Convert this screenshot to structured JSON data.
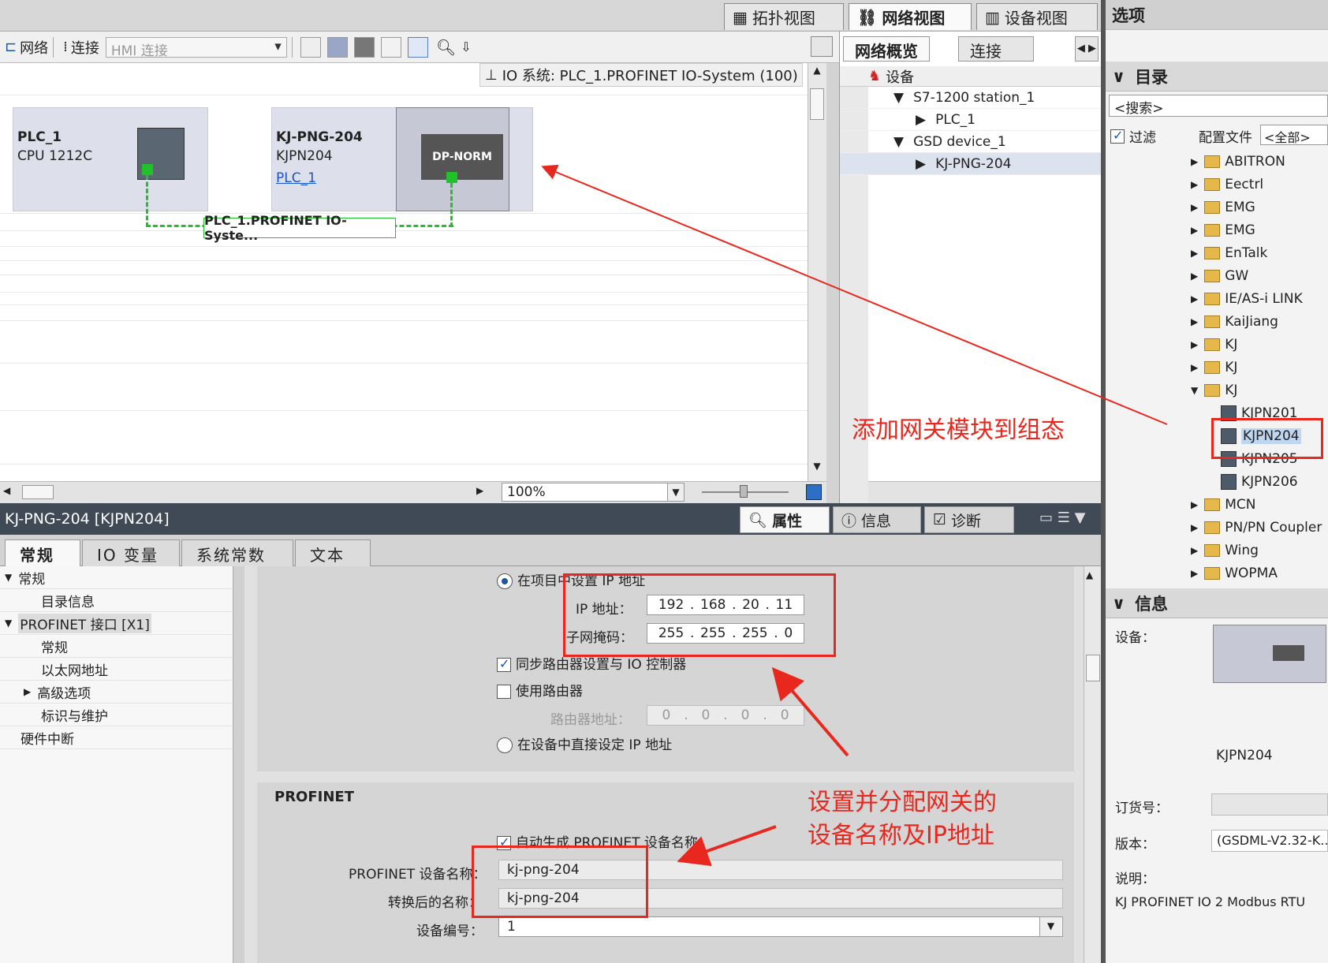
{
  "view_tabs": {
    "topology": "拓扑视图",
    "network": "网络视图",
    "device": "设备视图"
  },
  "toolbar": {
    "network": "网络",
    "connect": "连接",
    "hmi_connection": "HMI 连接"
  },
  "io_system": "IO 系统: PLC_1.PROFINET IO-System (100)",
  "devices": {
    "plc": {
      "name": "PLC_1",
      "type": "CPU 1212C"
    },
    "gw": {
      "name": "KJ-PNG-204",
      "type": "KJPN204",
      "link": "PLC_1",
      "module": "DP-NORM"
    },
    "network_label": "PLC_1.PROFINET  IO-Syste..."
  },
  "zoom": "100%",
  "overview": {
    "tab_overview": "网络概览",
    "tab_connect": "连接",
    "col_device": "设备",
    "rows": [
      {
        "label": "S7-1200 station_1",
        "expanded": true
      },
      {
        "label": "PLC_1",
        "expanded": false
      },
      {
        "label": "GSD device_1",
        "expanded": true
      },
      {
        "label": "KJ-PNG-204",
        "expanded": false
      }
    ]
  },
  "options": {
    "title": "选项",
    "catalog": "目录",
    "search_placeholder": "<搜索>",
    "filter": "过滤",
    "profile_label": "配置文件",
    "profile_value": "<全部>",
    "items": [
      "ABITRON",
      "Eectrl",
      "EMG",
      "EMG",
      "EnTalk",
      "GW",
      "IE/AS-i LINK",
      "KaiJiang",
      "KJ",
      "KJ",
      "KJ",
      "KJPN201",
      "KJPN204",
      "KJPN205",
      "KJPN206",
      "MCN",
      "PN/PN Coupler",
      "Wing",
      "WOPMA"
    ],
    "info": "信息",
    "device_label": "设备：",
    "device_name": "KJPN204",
    "order_label": "订货号：",
    "version_label": "版本：",
    "version_value": "(GSDML-V2.32-K...",
    "desc_label": "说明：",
    "desc_value": "KJ PROFINET IO 2 Modbus RTU"
  },
  "props": {
    "header": "KJ-PNG-204 [KJPN204]",
    "tab_props": "属性",
    "tab_info": "信息",
    "tab_diag": "诊断",
    "subtabs": [
      "常规",
      "IO 变量",
      "系统常数",
      "文本"
    ],
    "tree": [
      "常规",
      "目录信息",
      "PROFINET 接口 [X1]",
      "常规",
      "以太网地址",
      "高级选项",
      "标识与维护",
      "硬件中断"
    ],
    "set_ip_in_project": "在项目中设置 IP 地址",
    "ip_label": "IP 地址：",
    "ip": [
      "192",
      "168",
      "20",
      "11"
    ],
    "mask_label": "子网掩码：",
    "mask": [
      "255",
      "255",
      "255",
      "0"
    ],
    "sync_router": "同步路由器设置与 IO 控制器",
    "use_router": "使用路由器",
    "router_label": "路由器地址：",
    "router": [
      "0",
      "0",
      "0",
      "0"
    ],
    "set_ip_on_device": "在设备中直接设定 IP 地址",
    "profinet_title": "PROFINET",
    "auto_name": "自动生成 PROFINET 设备名称",
    "pn_name_label": "PROFINET 设备名称：",
    "pn_name": "kj-png-204",
    "conv_name_label": "转换后的名称：",
    "conv_name": "kj-png-204",
    "dev_num_label": "设备编号：",
    "dev_num": "1"
  },
  "annotations": {
    "add_gateway": "添加网关模块到组态",
    "set_name_ip_1": "设置并分配网关的",
    "set_name_ip_2": "设备名称及IP地址"
  },
  "colors": {
    "annotation": "#e8281e",
    "network_green": "#22c02a",
    "header_dark": "#404a56"
  }
}
